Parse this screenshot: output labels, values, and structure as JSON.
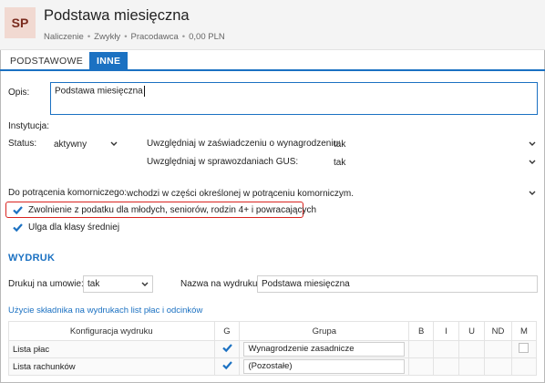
{
  "header": {
    "avatar": "SP",
    "title": "Podstawa miesięczna",
    "subtitle": [
      "Naliczenie",
      "Zwykły",
      "Pracodawca",
      "0,00 PLN"
    ]
  },
  "tabs": [
    {
      "label": "PODSTAWOWE",
      "active": false
    },
    {
      "label": "INNE",
      "active": true
    }
  ],
  "form": {
    "opis_label": "Opis:",
    "opis_value": "Podstawa miesięczna",
    "instytucja_label": "Instytucja:",
    "status_label": "Status:",
    "status_value": "aktywny",
    "zasw_label": "Uwzględniaj w zaświadczeniu o wynagrodzeniu:",
    "zasw_value": "tak",
    "gus_label": "Uwzględniaj w sprawozdaniach GUS:",
    "gus_value": "tak",
    "komornicze_label": "Do potrącenia komorniczego:",
    "komornicze_value": "wchodzi w części określonej w potrąceniu komorniczym.",
    "zwolnienie_label": "Zwolnienie z podatku dla młodych, seniorów, rodzin 4+ i powracających",
    "zwolnienie_checked": true,
    "ulga_label": "Ulga dla klasy średniej",
    "ulga_checked": true
  },
  "wydruk": {
    "title": "WYDRUK",
    "drukuj_label": "Drukuj na umowie:",
    "drukuj_value": "tak",
    "nazwa_label": "Nazwa na wydruku:",
    "nazwa_value": "Podstawa miesięczna",
    "link": "Użycie składnika na wydrukach list płac i odcinków"
  },
  "table": {
    "headers": [
      "Konfiguracja wydruku",
      "G",
      "Grupa",
      "B",
      "I",
      "U",
      "ND",
      "M"
    ],
    "rows": [
      {
        "config": "Lista płac",
        "g": true,
        "grupa": "Wynagrodzenie zasadnicze",
        "m": false
      },
      {
        "config": "Lista rachunków",
        "g": true,
        "grupa": "(Pozostałe)",
        "m": null
      }
    ]
  },
  "colors": {
    "accent": "#1b71c2",
    "highlight_border": "#d9231f",
    "avatar_bg": "#f1d9d1",
    "avatar_text": "#7a2b1e"
  }
}
